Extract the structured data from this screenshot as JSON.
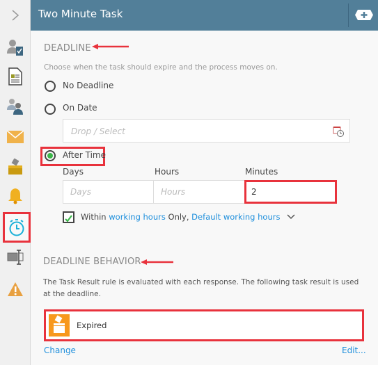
{
  "header": {
    "title": "Two Minute Task",
    "add_icon": "plus-tag-icon"
  },
  "sidebar": {
    "items": [
      {
        "icon": "chevron-right-icon"
      },
      {
        "icon": "user-task-icon"
      },
      {
        "icon": "form-icon"
      },
      {
        "icon": "participants-icon"
      },
      {
        "icon": "email-icon"
      },
      {
        "icon": "task-result-icon"
      },
      {
        "icon": "bell-icon"
      },
      {
        "icon": "stopwatch-icon",
        "active": true
      },
      {
        "icon": "text-field-icon"
      },
      {
        "icon": "warning-icon"
      }
    ]
  },
  "deadline": {
    "heading": "DEADLINE",
    "description": "Choose when the task should expire and the process moves on.",
    "options": [
      "No Deadline",
      "On Date",
      "After Time"
    ],
    "selected": "After Time",
    "date_placeholder": "Drop / Select",
    "labels": {
      "days": "Days",
      "hours": "Hours",
      "minutes": "Minutes"
    },
    "placeholders": {
      "days": "Days",
      "hours": "Hours"
    },
    "minutes_value": "2",
    "working": {
      "checked": true,
      "prefix": "Within ",
      "link1": "working hours",
      "middle": " Only, ",
      "link2": "Default working hours"
    }
  },
  "behavior": {
    "heading": "DEADLINE BEHAVIOR",
    "description": "The Task Result rule is evaluated with each response. The following task result is used at the deadline.",
    "result": "Expired",
    "change": "Change",
    "edit": "Edit..."
  },
  "colors": {
    "header": "#527f99",
    "accent": "#1e8fdc",
    "highlight": "#e8323c",
    "selected": "#3cb54a",
    "result": "#f7981d"
  }
}
